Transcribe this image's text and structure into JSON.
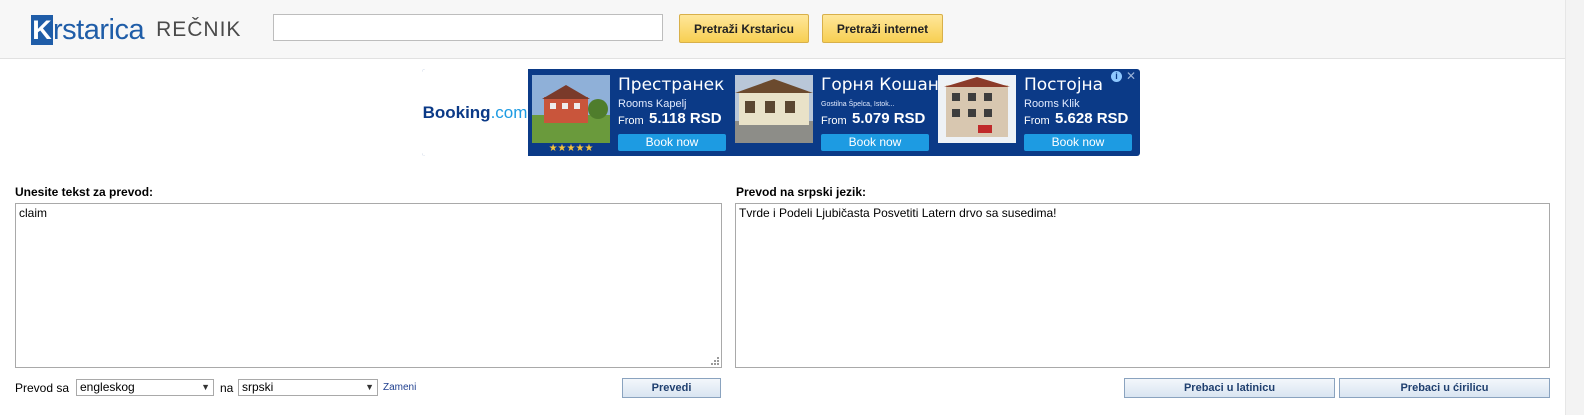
{
  "header": {
    "logo_k": "K",
    "logo_rest": "rstarica",
    "logo_sub": "REČNIK",
    "search_value": "",
    "btn_search_site": "Pretraži Krstaricu",
    "btn_search_web": "Pretraži internet"
  },
  "ad": {
    "brand_main": "Booking",
    "brand_dot": ".com",
    "cards": [
      {
        "title": "Престранек",
        "subtitle": "Rooms Kapelj",
        "from": "From",
        "price": "5.118 RSD",
        "button": "Book now",
        "stars": "★★★★★"
      },
      {
        "title": "Горня Кошана",
        "subtitle": "Gostilna Špelca, Istok...",
        "from": "From",
        "price": "5.079 RSD",
        "button": "Book now"
      },
      {
        "title": "Постојна",
        "subtitle": "Rooms Klik",
        "from": "From",
        "price": "5.628 RSD",
        "button": "Book now"
      }
    ],
    "info_icon": "i",
    "close_icon": "✕"
  },
  "translate": {
    "input_label": "Unesite tekst za prevod:",
    "input_value": "claim",
    "output_label": "Prevod na srpski jezik:",
    "output_value": "Tvrde i Podeli Ljubičasta Posvetiti Latern drvo sa susedima!",
    "from_label": "Prevod sa",
    "from_lang": "engleskog",
    "to_label": "na",
    "to_lang": "srpski",
    "swap_link": "Zameni",
    "translate_button": "Prevedi",
    "latin_button": "Prebaci u latinicu",
    "cyrillic_button": "Prebaci u ćirilicu"
  },
  "colors": {
    "brand": "#1f5da8",
    "ad_bg": "#0b3a87",
    "ad_button": "#1d9be2",
    "yellow_button": "#f7cf52"
  }
}
